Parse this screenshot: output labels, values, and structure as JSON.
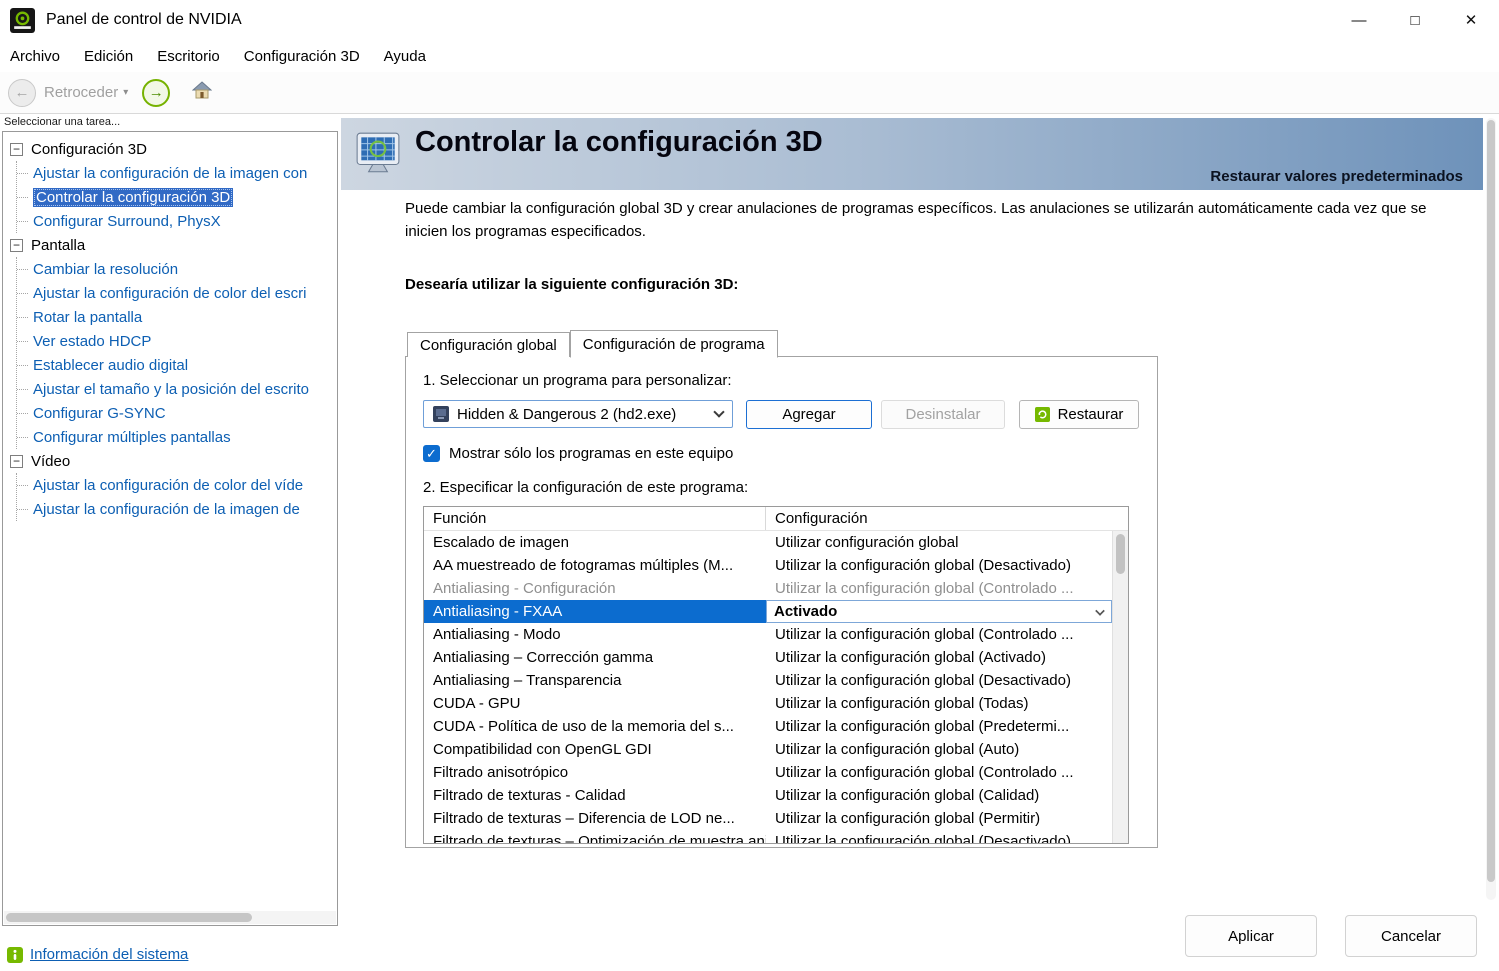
{
  "window": {
    "title": "Panel de control de NVIDIA"
  },
  "icons": {
    "minimize": "—",
    "maximize": "□",
    "close": "✕",
    "back_arrow": "←",
    "forward_arrow": "→",
    "caret_down": "▾",
    "check": "✓",
    "collapse": "−"
  },
  "menubar": [
    "Archivo",
    "Edición",
    "Escritorio",
    "Configuración 3D",
    "Ayuda"
  ],
  "toolbar": {
    "back_label": "Retroceder"
  },
  "sidebar": {
    "header": "Seleccionar una tarea...",
    "sections": [
      {
        "label": "Configuración 3D",
        "children": [
          "Ajustar la configuración de la imagen con",
          "Controlar la configuración 3D",
          "Configurar Surround, PhysX"
        ]
      },
      {
        "label": "Pantalla",
        "children": [
          "Cambiar la resolución",
          "Ajustar la configuración de color del escri",
          "Rotar la pantalla",
          "Ver estado HDCP",
          "Establecer audio digital",
          "Ajustar el tamaño y la posición del escrito",
          "Configurar G-SYNC",
          "Configurar múltiples pantallas"
        ]
      },
      {
        "label": "Vídeo",
        "children": [
          "Ajustar la configuración de color del víde",
          "Ajustar la configuración de la imagen de"
        ]
      }
    ],
    "selected_item": "Controlar la configuración 3D",
    "system_info": "Información del sistema"
  },
  "content": {
    "page_title": "Controlar la configuración 3D",
    "restore_defaults": "Restaurar valores predeterminados",
    "description": "Puede cambiar la configuración global 3D y crear anulaciones de programas específicos. Las anulaciones se utilizarán automáticamente cada vez que se inicien los programas especificados.",
    "question": "Desearía utilizar la siguiente configuración 3D:",
    "tabs": [
      "Configuración global",
      "Configuración de programa"
    ],
    "active_tab": "Configuración de programa",
    "step1_label": "1. Seleccionar un programa para personalizar:",
    "program_combo": {
      "value": "Hidden & Dangerous 2 (hd2.exe)"
    },
    "buttons": {
      "add": "Agregar",
      "uninstall": "Desinstalar",
      "restore": "Restaurar"
    },
    "show_only_checkbox": "Mostrar sólo los programas en este equipo",
    "step2_label": "2. Especificar la configuración de este programa:",
    "settings_table": {
      "headers": [
        "Función",
        "Configuración"
      ],
      "rows": [
        {
          "func": "Escalado de imagen",
          "setting": "Utilizar configuración global",
          "state": "normal"
        },
        {
          "func": "AA muestreado de fotogramas múltiples (M...",
          "setting": "Utilizar la configuración global (Desactivado)",
          "state": "normal"
        },
        {
          "func": "Antialiasing - Configuración",
          "setting": "Utilizar la configuración global (Controlado ...",
          "state": "disabled"
        },
        {
          "func": "Antialiasing - FXAA",
          "setting": "Activado",
          "state": "selected"
        },
        {
          "func": "Antialiasing - Modo",
          "setting": "Utilizar la configuración global (Controlado ...",
          "state": "normal"
        },
        {
          "func": "Antialiasing – Corrección gamma",
          "setting": "Utilizar la configuración global (Activado)",
          "state": "normal"
        },
        {
          "func": "Antialiasing – Transparencia",
          "setting": "Utilizar la configuración global (Desactivado)",
          "state": "normal"
        },
        {
          "func": "CUDA - GPU",
          "setting": "Utilizar la configuración global (Todas)",
          "state": "normal"
        },
        {
          "func": "CUDA - Política de uso de la memoria del s...",
          "setting": "Utilizar la configuración global (Predetermi...",
          "state": "normal"
        },
        {
          "func": "Compatibilidad con OpenGL GDI",
          "setting": "Utilizar la configuración global (Auto)",
          "state": "normal"
        },
        {
          "func": "Filtrado anisotrópico",
          "setting": "Utilizar la configuración global (Controlado ...",
          "state": "normal"
        },
        {
          "func": "Filtrado de texturas - Calidad",
          "setting": "Utilizar la configuración global (Calidad)",
          "state": "normal"
        },
        {
          "func": "Filtrado de texturas – Diferencia de LOD ne...",
          "setting": "Utilizar la configuración global (Permitir)",
          "state": "normal"
        },
        {
          "func": "Filtrado de texturas – Optimización de muestra anisotrópica",
          "setting": "Utilizar la configuración global (Desactivado)",
          "state": "normal"
        }
      ]
    },
    "apply_button": "Aplicar",
    "cancel_button": "Cancelar"
  }
}
